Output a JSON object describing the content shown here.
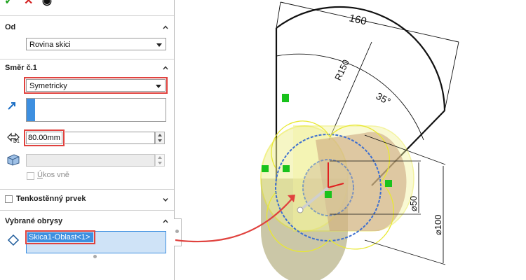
{
  "toolbar": {
    "ok_icon": "check-icon",
    "cancel_icon": "x-icon",
    "preview_icon": "eye-icon"
  },
  "from": {
    "title": "Od",
    "value": "Rovina skici"
  },
  "direction1": {
    "title": "Směr č.1",
    "end_condition": "Symetricky",
    "depth": "80.00mm",
    "draft_outward_prefix": "Ú",
    "draft_outward_rest": "kos vně"
  },
  "thin": {
    "title": "Tenkostěnný prvek"
  },
  "contours": {
    "title": "Vybrané obrysy",
    "item": "Skica1-Oblast<1>"
  },
  "dims": {
    "length": "160",
    "radius": "R150",
    "angle": "35°",
    "d50": "⌀50",
    "d100": "⌀100"
  },
  "colors": {
    "accent": "#e0423e",
    "selection": "#3d8fe0",
    "model_yellow": "#f0f080",
    "model_grey": "#b8b48a",
    "green": "#19c21c"
  }
}
